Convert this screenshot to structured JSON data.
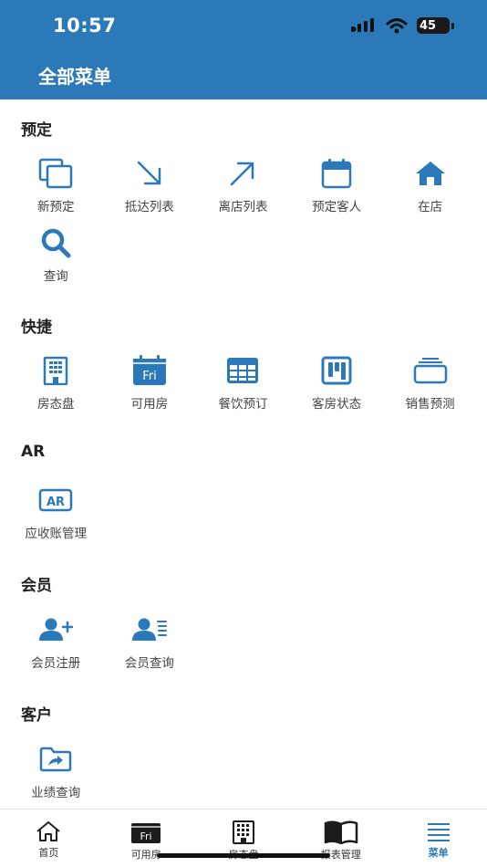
{
  "status_bar": {
    "time": "10:57",
    "battery": "45"
  },
  "header": {
    "title": "全部菜单"
  },
  "colors": {
    "brand": "#2b79b8",
    "icon": "#2b79b8"
  },
  "sections": [
    {
      "title": "预定",
      "items": [
        {
          "label": "新预定",
          "icon": "copy-icon"
        },
        {
          "label": "抵达列表",
          "icon": "arrow-down-right-icon"
        },
        {
          "label": "离店列表",
          "icon": "arrow-up-right-icon"
        },
        {
          "label": "预定客人",
          "icon": "calendar-icon"
        },
        {
          "label": "在店",
          "icon": "house-icon"
        },
        {
          "label": "查询",
          "icon": "search-icon"
        }
      ]
    },
    {
      "title": "快捷",
      "items": [
        {
          "label": "房态盘",
          "icon": "building-icon"
        },
        {
          "label": "可用房",
          "icon": "calendar-fri-icon",
          "icon_text": "Fri"
        },
        {
          "label": "餐饮预订",
          "icon": "table-icon"
        },
        {
          "label": "客房状态",
          "icon": "kanban-icon"
        },
        {
          "label": "销售预测",
          "icon": "layers-icon"
        }
      ]
    },
    {
      "title": "AR",
      "items": [
        {
          "label": "应收账管理",
          "icon": "ar-badge-icon",
          "icon_text": "AR"
        }
      ]
    },
    {
      "title": "会员",
      "items": [
        {
          "label": "会员注册",
          "icon": "user-plus-icon"
        },
        {
          "label": "会员查询",
          "icon": "user-list-icon"
        }
      ]
    },
    {
      "title": "客户",
      "items": [
        {
          "label": "业绩查询",
          "icon": "folder-share-icon"
        }
      ]
    }
  ],
  "bottom_nav": [
    {
      "label": "首页",
      "icon": "home-outline-icon"
    },
    {
      "label": "可用房",
      "icon": "calendar-fri-dark-icon",
      "icon_text": "Fri"
    },
    {
      "label": "房态盘",
      "icon": "building-dark-icon"
    },
    {
      "label": "报表管理",
      "icon": "book-icon"
    },
    {
      "label": "菜单",
      "icon": "menu-icon",
      "active": true
    }
  ]
}
